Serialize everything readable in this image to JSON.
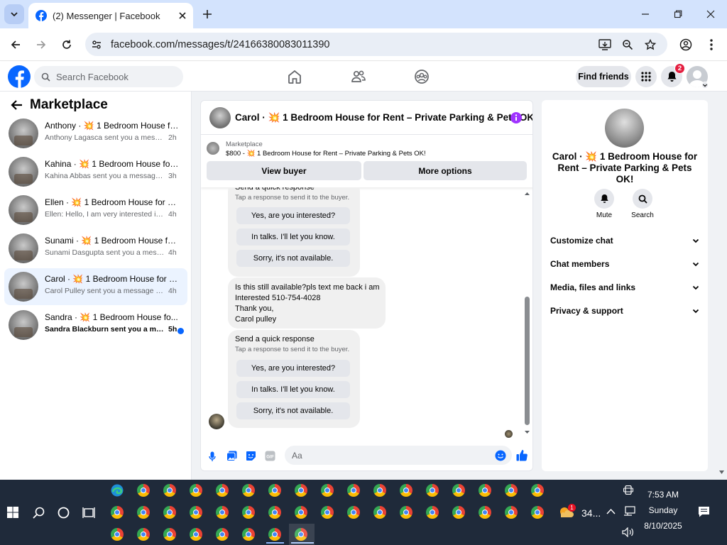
{
  "browser": {
    "tab_title": "(2) Messenger | Facebook",
    "url": "facebook.com/messages/t/24166380083011390"
  },
  "fb": {
    "search_placeholder": "Search Facebook",
    "find_friends": "Find friends",
    "notification_count": "2"
  },
  "left": {
    "title": "Marketplace",
    "conversations": [
      {
        "name": "Anthony · 💥 1 Bedroom House fo...",
        "preview": "Anthony Lagasca sent you a message ...",
        "time": "2h",
        "unread": false,
        "active": false
      },
      {
        "name": "Kahina · 💥 1 Bedroom House for ...",
        "preview": "Kahina Abbas sent you a message ab...",
        "time": "3h",
        "unread": false,
        "active": false
      },
      {
        "name": "Ellen · 💥 1 Bedroom House for Re...",
        "preview": "Ellen: Hello, I am very interested in ren...",
        "time": "4h",
        "unread": false,
        "active": false
      },
      {
        "name": "Sunami · 💥 1 Bedroom House for ...",
        "preview": "Sunami Dasgupta sent you a message...",
        "time": "4h",
        "unread": false,
        "active": false
      },
      {
        "name": "Carol · 💥 1 Bedroom House for Re...",
        "preview": "Carol Pulley sent you a message abou...",
        "time": "4h",
        "unread": false,
        "active": true
      },
      {
        "name": "Sandra · 💥 1 Bedroom House fo...",
        "preview": "Sandra Blackburn sent you a mess...",
        "time": "5h",
        "unread": true,
        "active": false
      }
    ]
  },
  "chat": {
    "title": "Carol · 💥 1 Bedroom House for Rent – Private Parking & Pets OK!",
    "marketplace_label": "Marketplace",
    "listing": "$800 - 💥 1 Bedroom House for Rent – Private Parking & Pets OK!",
    "view_buyer": "View buyer",
    "more_options": "More options",
    "quick_response_title": "Send a quick response",
    "quick_response_sub": "Tap a response to send it to the buyer.",
    "responses": [
      "Yes, are you interested?",
      "In talks. I'll let you know.",
      "Sorry, it's not available."
    ],
    "message_lines": [
      "Is this still available?pls text me back i am",
      "Interested 510-754-4028",
      "Thank you,",
      "Carol pulley"
    ],
    "composer_placeholder": "Aa"
  },
  "right": {
    "title": "Carol · 💥 1 Bedroom House for Rent – Private Parking & Pets OK!",
    "mute": "Mute",
    "search": "Search",
    "sections": [
      "Customize chat",
      "Chat members",
      "Media, files and links",
      "Privacy & support"
    ]
  },
  "taskbar": {
    "time": "7:53 AM",
    "day": "Sunday",
    "date": "8/10/2025",
    "weather_temp": "34...",
    "weather_badge": "1"
  },
  "colors": {
    "fb_blue": "#0866ff",
    "messenger_purple": "#a033ff",
    "badge_red": "#e41e3f",
    "chrome_tabbar": "#d3e3fd",
    "taskbar": "#1f2a3a"
  }
}
